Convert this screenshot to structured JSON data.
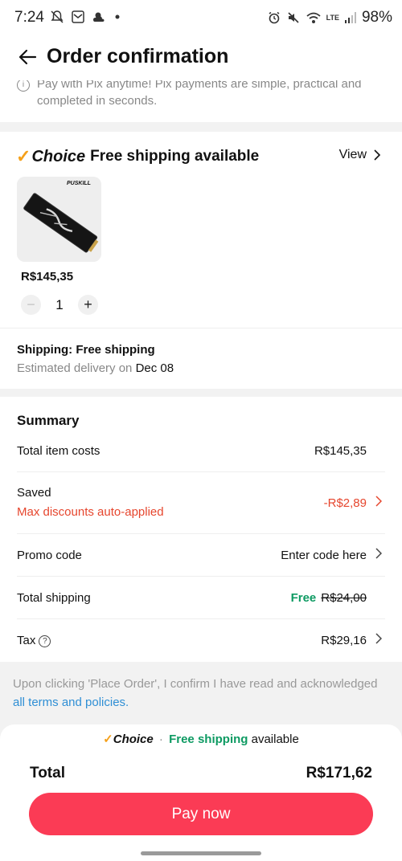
{
  "status_bar": {
    "time": "7:24",
    "battery": "98%",
    "lte_label": "LTE"
  },
  "header": {
    "title": "Order confirmation",
    "back_icon": "arrow-left-icon"
  },
  "pix_note": {
    "text": "Pay with Pix anytime! Pix payments are simple, practical and completed in seconds."
  },
  "store": {
    "choice_label": "Choice",
    "shipping_text": "Free shipping available",
    "view_label": "View"
  },
  "product": {
    "brand": "PUSKILL",
    "price": "R$145,35",
    "quantity": "1",
    "minus": "−",
    "plus": "+"
  },
  "shipping": {
    "title": "Shipping: Free shipping",
    "estimate_prefix": "Estimated delivery on",
    "estimate_date": "Dec 08"
  },
  "summary": {
    "title": "Summary",
    "total_item_costs_label": "Total item costs",
    "total_item_costs_value": "R$145,35",
    "saved_label": "Saved",
    "saved_sub": "Max discounts auto-applied",
    "saved_value": "-R$2,89",
    "promo_label": "Promo code",
    "promo_value": "Enter code here",
    "shipping_label": "Total shipping",
    "shipping_free": "Free",
    "shipping_original": "R$24,00",
    "tax_label": "Tax",
    "tax_value": "R$29,16"
  },
  "terms": {
    "text": "Upon clicking 'Place Order', I confirm I have read and acknowledged",
    "link": "all terms and policies."
  },
  "footer": {
    "choice_label": "Choice",
    "separator": "·",
    "free_label": "Free shipping",
    "available": "available",
    "total_label": "Total",
    "total_value": "R$171,62",
    "pay_label": "Pay now"
  },
  "colors": {
    "accent": "#fb3b55",
    "discount": "#e6462e",
    "free": "#0d9a62",
    "choice": "#f5a01a",
    "link": "#2f8fd5"
  }
}
